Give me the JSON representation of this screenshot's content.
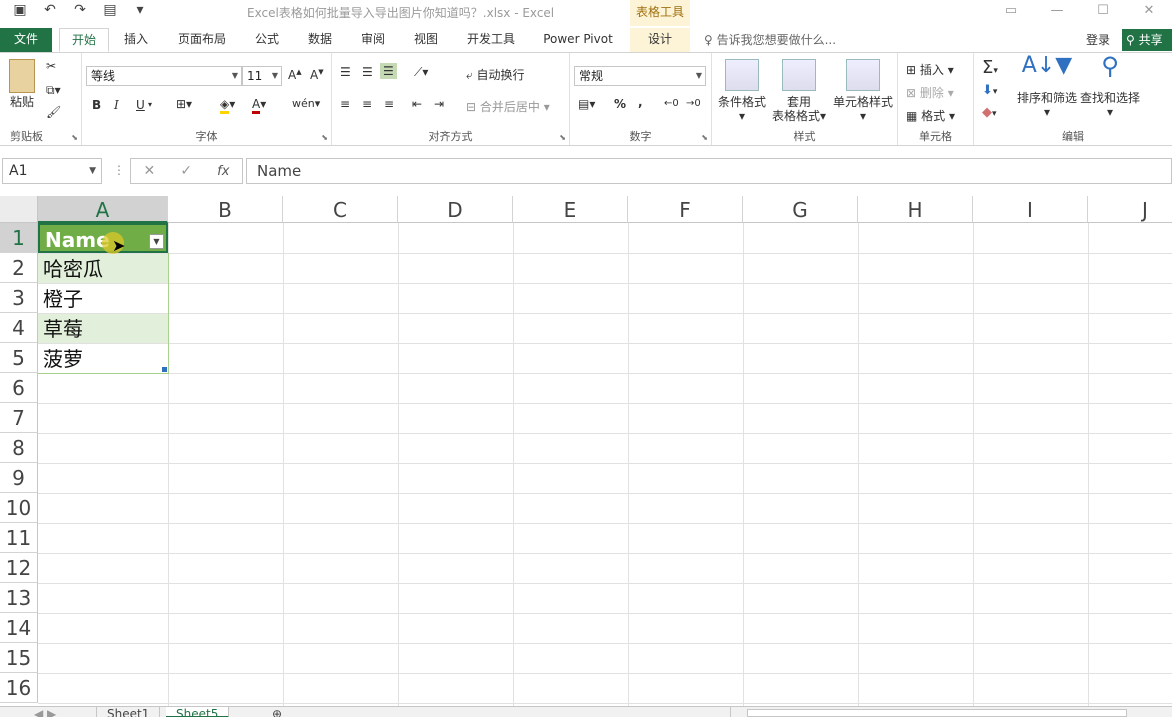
{
  "app": {
    "window_title": "Excel表格如何批量导入导出图片你知道吗？.xlsx - Excel",
    "context_tab_title": "表格工具"
  },
  "qat": {
    "save_icon": "save-icon",
    "undo_icon": "undo-icon",
    "redo_icon": "redo-icon",
    "customize_icon": "customize-qat-icon"
  },
  "ribbon_tabs": [
    "文件",
    "开始",
    "插入",
    "页面布局",
    "公式",
    "数据",
    "审阅",
    "视图",
    "开发工具",
    "Power Pivot",
    "设计"
  ],
  "active_tab": "开始",
  "tell_me": "告诉我您想要做什么...",
  "login": "登录",
  "share": "共享",
  "groups": {
    "clipboard": {
      "label": "剪贴板",
      "paste": "粘贴"
    },
    "font": {
      "label": "字体",
      "font_name": "等线",
      "font_size": "11",
      "bold": "B",
      "italic": "I",
      "underline": "U",
      "wen": "wén"
    },
    "alignment": {
      "label": "对齐方式",
      "wrap": "自动换行",
      "merge": "合并后居中"
    },
    "number": {
      "label": "数字",
      "format": "常规",
      "percent": "%",
      "comma": ","
    },
    "styles": {
      "label": "样式",
      "conditional": "条件格式",
      "table_fmt_1": "套用",
      "table_fmt_2": "表格格式",
      "cell_styles": "单元格样式"
    },
    "cells": {
      "label": "单元格",
      "insert": "插入",
      "delete": "删除",
      "format": "格式"
    },
    "editing": {
      "label": "编辑",
      "sort": "排序和筛选",
      "find": "查找和选择"
    }
  },
  "formula_bar": {
    "name_box": "A1",
    "formula": "Name",
    "fx": "fx"
  },
  "columns": [
    "A",
    "B",
    "C",
    "D",
    "E",
    "F",
    "G",
    "H",
    "I",
    "J"
  ],
  "rows": [
    "1",
    "2",
    "3",
    "4",
    "5",
    "6",
    "7",
    "8",
    "9",
    "10",
    "11",
    "12",
    "13",
    "14",
    "15",
    "16"
  ],
  "table": {
    "header": "Name",
    "values": [
      "哈密瓜",
      "橙子",
      "草莓",
      "菠萝"
    ]
  },
  "sheets": [
    "Sheet1",
    "Sheet5"
  ],
  "active_sheet": "Sheet5",
  "colors": {
    "accent": "#217346",
    "table_header": "#70ad47",
    "table_band": "#e2efda",
    "context_tab": "#fdf3d6"
  }
}
